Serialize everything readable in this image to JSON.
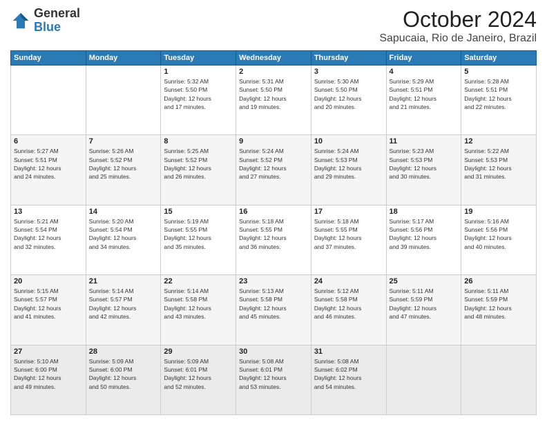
{
  "header": {
    "logo_general": "General",
    "logo_blue": "Blue",
    "month": "October 2024",
    "location": "Sapucaia, Rio de Janeiro, Brazil"
  },
  "days_of_week": [
    "Sunday",
    "Monday",
    "Tuesday",
    "Wednesday",
    "Thursday",
    "Friday",
    "Saturday"
  ],
  "weeks": [
    [
      {
        "day": "",
        "info": ""
      },
      {
        "day": "",
        "info": ""
      },
      {
        "day": "1",
        "info": "Sunrise: 5:32 AM\nSunset: 5:50 PM\nDaylight: 12 hours\nand 17 minutes."
      },
      {
        "day": "2",
        "info": "Sunrise: 5:31 AM\nSunset: 5:50 PM\nDaylight: 12 hours\nand 19 minutes."
      },
      {
        "day": "3",
        "info": "Sunrise: 5:30 AM\nSunset: 5:50 PM\nDaylight: 12 hours\nand 20 minutes."
      },
      {
        "day": "4",
        "info": "Sunrise: 5:29 AM\nSunset: 5:51 PM\nDaylight: 12 hours\nand 21 minutes."
      },
      {
        "day": "5",
        "info": "Sunrise: 5:28 AM\nSunset: 5:51 PM\nDaylight: 12 hours\nand 22 minutes."
      }
    ],
    [
      {
        "day": "6",
        "info": "Sunrise: 5:27 AM\nSunset: 5:51 PM\nDaylight: 12 hours\nand 24 minutes."
      },
      {
        "day": "7",
        "info": "Sunrise: 5:26 AM\nSunset: 5:52 PM\nDaylight: 12 hours\nand 25 minutes."
      },
      {
        "day": "8",
        "info": "Sunrise: 5:25 AM\nSunset: 5:52 PM\nDaylight: 12 hours\nand 26 minutes."
      },
      {
        "day": "9",
        "info": "Sunrise: 5:24 AM\nSunset: 5:52 PM\nDaylight: 12 hours\nand 27 minutes."
      },
      {
        "day": "10",
        "info": "Sunrise: 5:24 AM\nSunset: 5:53 PM\nDaylight: 12 hours\nand 29 minutes."
      },
      {
        "day": "11",
        "info": "Sunrise: 5:23 AM\nSunset: 5:53 PM\nDaylight: 12 hours\nand 30 minutes."
      },
      {
        "day": "12",
        "info": "Sunrise: 5:22 AM\nSunset: 5:53 PM\nDaylight: 12 hours\nand 31 minutes."
      }
    ],
    [
      {
        "day": "13",
        "info": "Sunrise: 5:21 AM\nSunset: 5:54 PM\nDaylight: 12 hours\nand 32 minutes."
      },
      {
        "day": "14",
        "info": "Sunrise: 5:20 AM\nSunset: 5:54 PM\nDaylight: 12 hours\nand 34 minutes."
      },
      {
        "day": "15",
        "info": "Sunrise: 5:19 AM\nSunset: 5:55 PM\nDaylight: 12 hours\nand 35 minutes."
      },
      {
        "day": "16",
        "info": "Sunrise: 5:18 AM\nSunset: 5:55 PM\nDaylight: 12 hours\nand 36 minutes."
      },
      {
        "day": "17",
        "info": "Sunrise: 5:18 AM\nSunset: 5:55 PM\nDaylight: 12 hours\nand 37 minutes."
      },
      {
        "day": "18",
        "info": "Sunrise: 5:17 AM\nSunset: 5:56 PM\nDaylight: 12 hours\nand 39 minutes."
      },
      {
        "day": "19",
        "info": "Sunrise: 5:16 AM\nSunset: 5:56 PM\nDaylight: 12 hours\nand 40 minutes."
      }
    ],
    [
      {
        "day": "20",
        "info": "Sunrise: 5:15 AM\nSunset: 5:57 PM\nDaylight: 12 hours\nand 41 minutes."
      },
      {
        "day": "21",
        "info": "Sunrise: 5:14 AM\nSunset: 5:57 PM\nDaylight: 12 hours\nand 42 minutes."
      },
      {
        "day": "22",
        "info": "Sunrise: 5:14 AM\nSunset: 5:58 PM\nDaylight: 12 hours\nand 43 minutes."
      },
      {
        "day": "23",
        "info": "Sunrise: 5:13 AM\nSunset: 5:58 PM\nDaylight: 12 hours\nand 45 minutes."
      },
      {
        "day": "24",
        "info": "Sunrise: 5:12 AM\nSunset: 5:58 PM\nDaylight: 12 hours\nand 46 minutes."
      },
      {
        "day": "25",
        "info": "Sunrise: 5:11 AM\nSunset: 5:59 PM\nDaylight: 12 hours\nand 47 minutes."
      },
      {
        "day": "26",
        "info": "Sunrise: 5:11 AM\nSunset: 5:59 PM\nDaylight: 12 hours\nand 48 minutes."
      }
    ],
    [
      {
        "day": "27",
        "info": "Sunrise: 5:10 AM\nSunset: 6:00 PM\nDaylight: 12 hours\nand 49 minutes."
      },
      {
        "day": "28",
        "info": "Sunrise: 5:09 AM\nSunset: 6:00 PM\nDaylight: 12 hours\nand 50 minutes."
      },
      {
        "day": "29",
        "info": "Sunrise: 5:09 AM\nSunset: 6:01 PM\nDaylight: 12 hours\nand 52 minutes."
      },
      {
        "day": "30",
        "info": "Sunrise: 5:08 AM\nSunset: 6:01 PM\nDaylight: 12 hours\nand 53 minutes."
      },
      {
        "day": "31",
        "info": "Sunrise: 5:08 AM\nSunset: 6:02 PM\nDaylight: 12 hours\nand 54 minutes."
      },
      {
        "day": "",
        "info": ""
      },
      {
        "day": "",
        "info": ""
      }
    ]
  ]
}
